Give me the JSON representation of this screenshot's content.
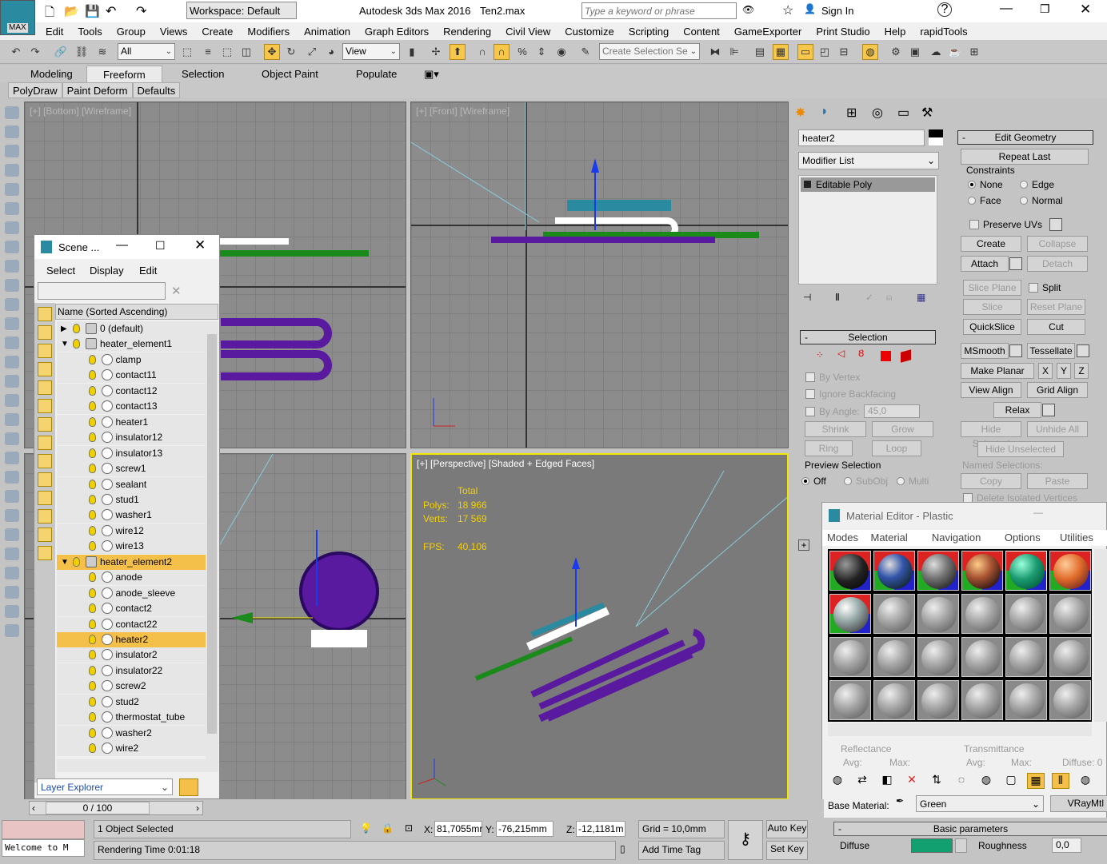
{
  "titlebar": {
    "app": "Autodesk 3ds Max 2016",
    "file": "Ten2.max",
    "workspace": "Workspace: Default",
    "search_placeholder": "Type a keyword or phrase",
    "sign_in": "Sign In",
    "logo": "MAX"
  },
  "menu": [
    "Edit",
    "Tools",
    "Group",
    "Views",
    "Create",
    "Modifiers",
    "Animation",
    "Graph Editors",
    "Rendering",
    "Civil View",
    "Customize",
    "Scripting",
    "Content",
    "GameExporter",
    "Print Studio",
    "Help",
    "rapidTools"
  ],
  "toolbar": {
    "filter": "All",
    "coord": "View",
    "named_selection": "Create Selection Se"
  },
  "ribbon": {
    "tabs": [
      "Modeling",
      "Freeform",
      "Selection",
      "Object Paint",
      "Populate"
    ],
    "active": "Freeform",
    "subtabs": [
      "PolyDraw",
      "Paint Deform",
      "Defaults"
    ]
  },
  "viewports": {
    "top_left": "[+] [Bottom] [Wireframe]",
    "top_right": "[+] [Front] [Wireframe]",
    "perspective": "[+] [Perspective] [Shaded + Edged Faces]",
    "stats": {
      "total": "Total",
      "polys_label": "Polys:",
      "polys": "18 966",
      "verts_label": "Verts:",
      "verts": "17 569",
      "fps_label": "FPS:",
      "fps": "40,106"
    }
  },
  "scene_explorer": {
    "title": "Scene ...",
    "menu": [
      "Select",
      "Display",
      "Edit"
    ],
    "column": "Name (Sorted Ascending)",
    "footer": "Layer Explorer",
    "rows": [
      {
        "name": "0 (default)",
        "level": 0,
        "type": "layer"
      },
      {
        "name": "heater_element1",
        "level": 0,
        "type": "layer",
        "expanded": true
      },
      {
        "name": "clamp",
        "level": 1
      },
      {
        "name": "contact11",
        "level": 1
      },
      {
        "name": "contact12",
        "level": 1
      },
      {
        "name": "contact13",
        "level": 1
      },
      {
        "name": "heater1",
        "level": 1
      },
      {
        "name": "insulator12",
        "level": 1
      },
      {
        "name": "insulator13",
        "level": 1
      },
      {
        "name": "screw1",
        "level": 1
      },
      {
        "name": "sealant",
        "level": 1
      },
      {
        "name": "stud1",
        "level": 1
      },
      {
        "name": "washer1",
        "level": 1
      },
      {
        "name": "wire12",
        "level": 1
      },
      {
        "name": "wire13",
        "level": 1
      },
      {
        "name": "heater_element2",
        "level": 0,
        "type": "layer",
        "expanded": true,
        "selected": true
      },
      {
        "name": "anode",
        "level": 1
      },
      {
        "name": "anode_sleeve",
        "level": 1
      },
      {
        "name": "contact2",
        "level": 1
      },
      {
        "name": "contact22",
        "level": 1
      },
      {
        "name": "heater2",
        "level": 1,
        "selected": true
      },
      {
        "name": "insulator2",
        "level": 1
      },
      {
        "name": "insulator22",
        "level": 1
      },
      {
        "name": "screw2",
        "level": 1
      },
      {
        "name": "stud2",
        "level": 1
      },
      {
        "name": "thermostat_tube",
        "level": 1
      },
      {
        "name": "washer2",
        "level": 1
      },
      {
        "name": "wire2",
        "level": 1
      }
    ]
  },
  "command_panel": {
    "object_name": "heater2",
    "modifier_list": "Modifier List",
    "stack": [
      "Editable Poly"
    ],
    "selection": {
      "title": "Selection",
      "by_vertex": "By Vertex",
      "ignore_backfacing": "Ignore Backfacing",
      "by_angle": "By Angle:",
      "angle": "45,0",
      "shrink": "Shrink",
      "grow": "Grow",
      "ring": "Ring",
      "loop": "Loop",
      "preview": "Preview Selection",
      "off": "Off",
      "subobj": "SubObj",
      "multi": "Multi"
    },
    "edit_geometry": {
      "title": "Edit Geometry",
      "repeat_last": "Repeat Last",
      "constraints": "Constraints",
      "none": "None",
      "edge": "Edge",
      "face": "Face",
      "normal": "Normal",
      "preserve_uvs": "Preserve UVs",
      "create": "Create",
      "collapse": "Collapse",
      "attach": "Attach",
      "detach": "Detach",
      "slice_plane": "Slice Plane",
      "split": "Split",
      "slice": "Slice",
      "reset_plane": "Reset Plane",
      "quickslice": "QuickSlice",
      "cut": "Cut",
      "msmooth": "MSmooth",
      "tessellate": "Tessellate",
      "make_planar": "Make Planar",
      "x": "X",
      "y": "Y",
      "z": "Z",
      "view_align": "View Align",
      "grid_align": "Grid Align",
      "relax": "Relax",
      "hide_selected": "Hide Selected",
      "unhide_all": "Unhide All",
      "hide_unselected": "Hide Unselected",
      "named_selections": "Named Selections:",
      "copy": "Copy",
      "paste": "Paste",
      "delete_isolated": "Delete Isolated Vertices"
    }
  },
  "material_editor": {
    "title": "Material Editor - Plastic",
    "menu": [
      "Modes",
      "Material",
      "Navigation",
      "Options",
      "Utilities"
    ],
    "reflectance": "Reflectance",
    "transmittance": "Transmittance",
    "avg": "Avg:",
    "max": "Max:",
    "diffuse_pct": "Diffuse: 0",
    "base_material_label": "Base Material:",
    "base_material": "Green",
    "material_type": "VRayMtl",
    "basic_params": "Basic parameters",
    "diffuse": "Diffuse",
    "diffuse_color": "#12a070",
    "roughness": "Roughness",
    "roughness_value": "0,0"
  },
  "status": {
    "time": "0 / 100",
    "selected": "1 Object Selected",
    "render_time": "Rendering Time  0:01:18",
    "x_label": "X:",
    "x": "81,7055mr",
    "y_label": "Y:",
    "y": "-76,215mm",
    "z_label": "Z:",
    "z": "-12,1181m",
    "grid": "Grid = 10,0mm",
    "add_time_tag": "Add Time Tag",
    "auto_key": "Auto Key",
    "set_key": "Set Key",
    "listener": "Welcome to M"
  },
  "colors": {
    "active_highlight": "#f5c04a",
    "viewport_border_active": "#f5e600"
  }
}
